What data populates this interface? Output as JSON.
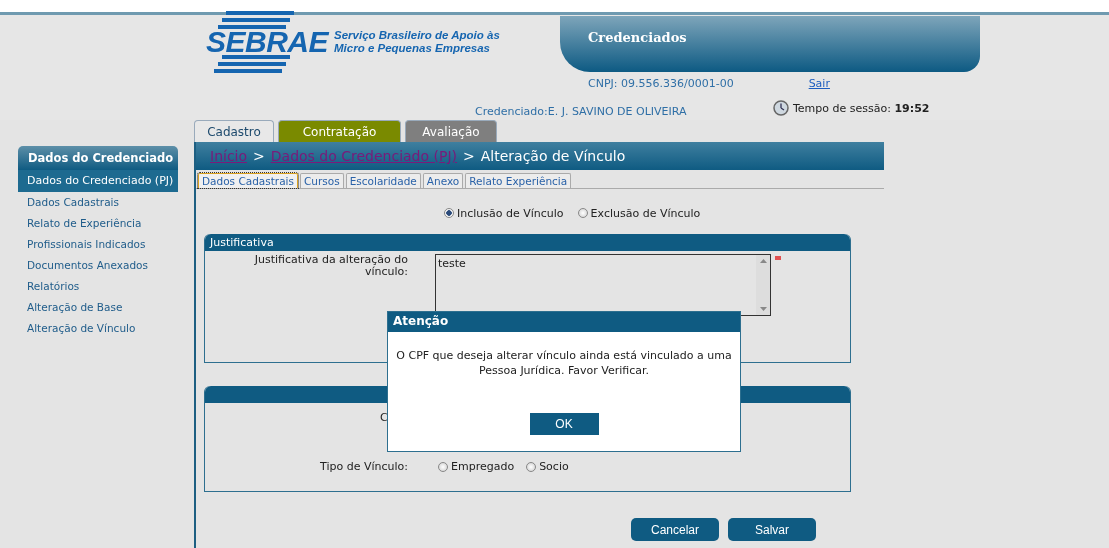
{
  "header": {
    "logo": {
      "wordmark": "SEBRAE",
      "tagline": [
        "Serviço Brasileiro de Apoio às",
        "Micro e Pequenas Empresas"
      ]
    },
    "app_title": "Credenciados",
    "cnpj": "CNPJ: 09.556.336/0001-00",
    "logout": "Sair",
    "credenciado": "Credenciado:E. J. SAVINO DE OLIVEIRA",
    "session": {
      "label": "Tempo de sessão:",
      "time": "19:52"
    }
  },
  "main_tabs": [
    {
      "label": "Cadastro",
      "selected": true,
      "color": "#e8e8e8"
    },
    {
      "label": "Contratação",
      "selected": false,
      "color": "#7a8a00"
    },
    {
      "label": "Avaliação",
      "selected": false,
      "color": "#7f7f7f"
    }
  ],
  "sidebar": {
    "title": "Dados do Credenciado",
    "items": [
      {
        "label": "Dados do Credenciado (PJ)",
        "selected": true
      },
      {
        "label": "Dados Cadastrais",
        "selected": false
      },
      {
        "label": "Relato de Experiência",
        "selected": false
      },
      {
        "label": "Profissionais Indicados",
        "selected": false
      },
      {
        "label": "Documentos Anexados",
        "selected": false
      },
      {
        "label": "Relatórios",
        "selected": false
      },
      {
        "label": "Alteração de Base",
        "selected": false
      },
      {
        "label": "Alteração de Vínculo",
        "selected": false
      }
    ]
  },
  "breadcrumb": [
    {
      "label": "Início",
      "kind": "link"
    },
    {
      "label": ">",
      "kind": "separator"
    },
    {
      "label": "Dados do Credenciado (PJ)",
      "kind": "link"
    },
    {
      "label": ">",
      "kind": "separator"
    },
    {
      "label": "Alteração de Vínculo",
      "kind": "current"
    }
  ],
  "sub_tabs": [
    {
      "label": "Dados Cadastrais",
      "selected": true
    },
    {
      "label": "Cursos",
      "selected": false
    },
    {
      "label": "Escolaridade",
      "selected": false
    },
    {
      "label": "Anexo",
      "selected": false
    },
    {
      "label": "Relato Experiência",
      "selected": false
    }
  ],
  "vinculo_options": [
    {
      "label": "Inclusão de Vínculo",
      "selected": true
    },
    {
      "label": "Exclusão de Vínculo",
      "selected": false
    }
  ],
  "justificativa": {
    "title": "Justificativa",
    "label": "Justificativa da alteração do vínculo:",
    "value": "teste",
    "required": true
  },
  "section2": {
    "partial_label": "C",
    "tipo_label": "Tipo de Vínculo:",
    "tipo_options": [
      {
        "label": "Empregado",
        "selected": false
      },
      {
        "label": "Socio",
        "selected": false
      }
    ]
  },
  "buttons": [
    "Cancelar",
    "Salvar"
  ],
  "dialog": {
    "title": "Atenção",
    "message": "O CPF que deseja alterar vínculo ainda está vinculado a uma Pessoa Jurídica. Favor Verificar.",
    "button": "OK"
  }
}
